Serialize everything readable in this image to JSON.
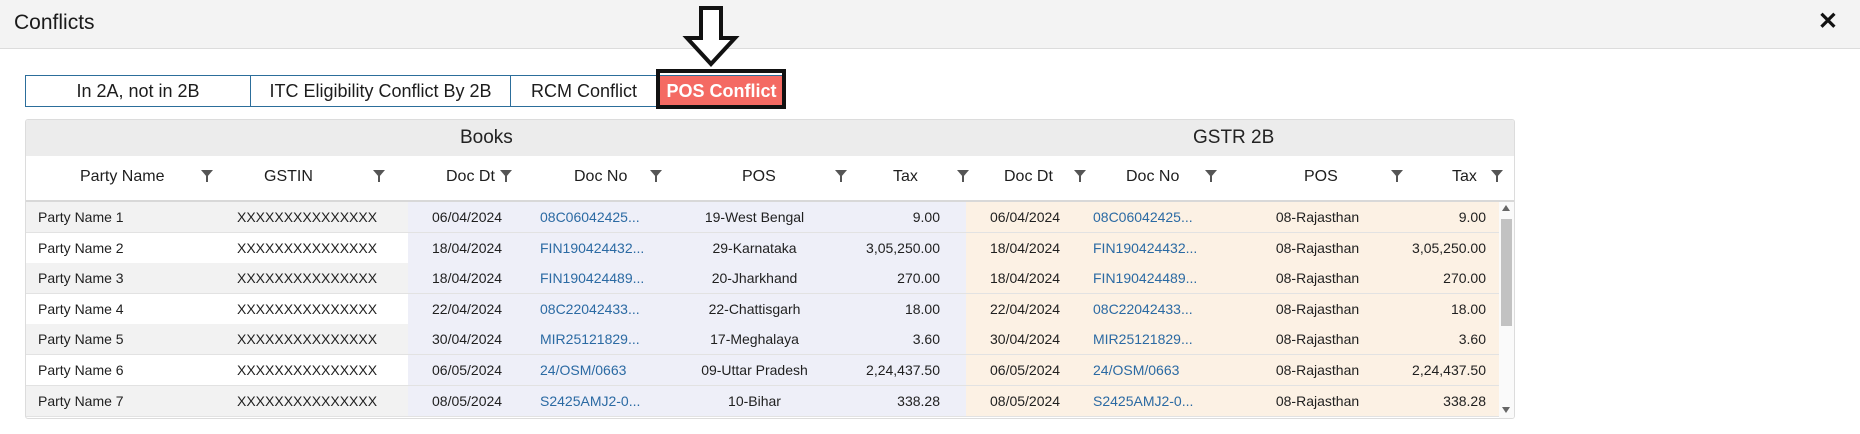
{
  "dialog": {
    "title": "Conflicts",
    "close_label": "✕"
  },
  "tabs": [
    {
      "label": "In 2A, not in 2B",
      "active": false
    },
    {
      "label": "ITC Eligibility Conflict By 2B",
      "active": false
    },
    {
      "label": "RCM Conflict",
      "active": false
    },
    {
      "label": "POS Conflict",
      "active": true
    }
  ],
  "grid": {
    "groups": {
      "books": "Books",
      "gstr2b": "GSTR 2B"
    },
    "columns": [
      "Party Name",
      "GSTIN",
      "Doc Dt",
      "Doc No",
      "POS",
      "Tax",
      "Doc Dt",
      "Doc No",
      "POS",
      "Tax"
    ],
    "rows": [
      {
        "party": "Party Name 1",
        "gstin": "XXXXXXXXXXXXXXX",
        "books_doc_dt": "06/04/2024",
        "books_doc_no": "08C06042425...",
        "books_pos": "19-West Bengal",
        "books_tax": "9.00",
        "gstr_doc_dt": "06/04/2024",
        "gstr_doc_no": "08C06042425...",
        "gstr_pos": "08-Rajasthan",
        "gstr_tax": "9.00"
      },
      {
        "party": "Party Name 2",
        "gstin": "XXXXXXXXXXXXXXX",
        "books_doc_dt": "18/04/2024",
        "books_doc_no": "FIN190424432...",
        "books_pos": "29-Karnataka",
        "books_tax": "3,05,250.00",
        "gstr_doc_dt": "18/04/2024",
        "gstr_doc_no": "FIN190424432...",
        "gstr_pos": "08-Rajasthan",
        "gstr_tax": "3,05,250.00"
      },
      {
        "party": "Party Name 3",
        "gstin": "XXXXXXXXXXXXXXX",
        "books_doc_dt": "18/04/2024",
        "books_doc_no": "FIN190424489...",
        "books_pos": "20-Jharkhand",
        "books_tax": "270.00",
        "gstr_doc_dt": "18/04/2024",
        "gstr_doc_no": "FIN190424489...",
        "gstr_pos": "08-Rajasthan",
        "gstr_tax": "270.00"
      },
      {
        "party": "Party Name 4",
        "gstin": "XXXXXXXXXXXXXXX",
        "books_doc_dt": "22/04/2024",
        "books_doc_no": "08C22042433...",
        "books_pos": "22-Chattisgarh",
        "books_tax": "18.00",
        "gstr_doc_dt": "22/04/2024",
        "gstr_doc_no": "08C22042433...",
        "gstr_pos": "08-Rajasthan",
        "gstr_tax": "18.00"
      },
      {
        "party": "Party Name 5",
        "gstin": "XXXXXXXXXXXXXXX",
        "books_doc_dt": "30/04/2024",
        "books_doc_no": "MIR25121829...",
        "books_pos": "17-Meghalaya",
        "books_tax": "3.60",
        "gstr_doc_dt": "30/04/2024",
        "gstr_doc_no": "MIR25121829...",
        "gstr_pos": "08-Rajasthan",
        "gstr_tax": "3.60"
      },
      {
        "party": "Party Name 6",
        "gstin": "XXXXXXXXXXXXXXX",
        "books_doc_dt": "06/05/2024",
        "books_doc_no": "24/OSM/0663",
        "books_pos": "09-Uttar Pradesh",
        "books_tax": "2,24,437.50",
        "gstr_doc_dt": "06/05/2024",
        "gstr_doc_no": "24/OSM/0663",
        "gstr_pos": "08-Rajasthan",
        "gstr_tax": "2,24,437.50"
      },
      {
        "party": "Party Name 7",
        "gstin": "XXXXXXXXXXXXXXX",
        "books_doc_dt": "08/05/2024",
        "books_doc_no": "S2425AMJ2-0...",
        "books_pos": "10-Bihar",
        "books_tax": "338.28",
        "gstr_doc_dt": "08/05/2024",
        "gstr_doc_no": "S2425AMJ2-0...",
        "gstr_pos": "08-Rajasthan",
        "gstr_tax": "338.28"
      }
    ]
  },
  "colors": {
    "active_tab": "#f46a63",
    "tab_border": "#2c6e9b",
    "books_band": "#eeeff8",
    "gstr_band": "#fcf1e4",
    "link": "#2b6aa3"
  },
  "annotation": {
    "arrow_icon": "down-arrow-icon",
    "highlight": "active-tab-highlight-box"
  }
}
